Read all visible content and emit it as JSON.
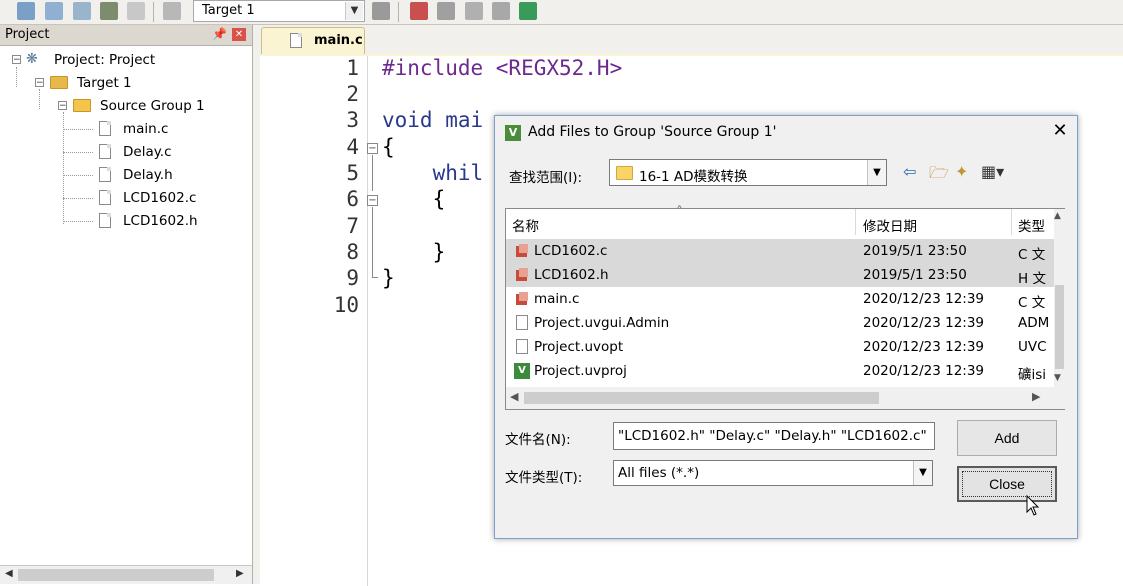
{
  "toolbar": {
    "target_select": "Target 1"
  },
  "project_panel": {
    "title": "Project",
    "tree": {
      "project": "Project: Project",
      "target": "Target 1",
      "group": "Source Group 1",
      "files": [
        "main.c",
        "Delay.c",
        "Delay.h",
        "LCD1602.c",
        "LCD1602.h"
      ]
    }
  },
  "editor": {
    "tab": "main.c",
    "line_numbers": [
      "1",
      "2",
      "3",
      "4",
      "5",
      "6",
      "7",
      "8",
      "9",
      "10"
    ],
    "code": [
      "#include <REGX52.H>",
      "",
      "void mai",
      "{",
      "    whil",
      "    {",
      "",
      "    }",
      "}",
      ""
    ]
  },
  "dialog": {
    "title": "Add Files to Group 'Source Group 1'",
    "look_in_label": "查找范围(I):",
    "look_in_value": "16-1 AD模数转换",
    "columns": {
      "name": "名称",
      "date": "修改日期",
      "type": "类型"
    },
    "files": [
      {
        "name": "LCD1602.c",
        "date": "2019/5/1 23:50",
        "type": "C 文",
        "selected": true,
        "icon": "c-file-icon"
      },
      {
        "name": "LCD1602.h",
        "date": "2019/5/1 23:50",
        "type": "H 文",
        "selected": true,
        "icon": "c-file-icon"
      },
      {
        "name": "main.c",
        "date": "2020/12/23 12:39",
        "type": "C 文",
        "selected": false,
        "icon": "c-file-icon"
      },
      {
        "name": "Project.uvgui.Admin",
        "date": "2020/12/23 12:39",
        "type": "ADM",
        "selected": false,
        "icon": "document-icon"
      },
      {
        "name": "Project.uvopt",
        "date": "2020/12/23 12:39",
        "type": "UVC",
        "selected": false,
        "icon": "document-icon"
      },
      {
        "name": "Project.uvproj",
        "date": "2020/12/23 12:39",
        "type": "礦isi",
        "selected": false,
        "icon": "uvision-project-icon"
      }
    ],
    "filename_label": "文件名(N):",
    "filename_value": "\"LCD1602.h\" \"Delay.c\" \"Delay.h\" \"LCD1602.c\"",
    "filetype_label": "文件类型(T):",
    "filetype_value": "All files (*.*)",
    "add_button": "Add",
    "close_button": "Close"
  },
  "colors": {
    "tab_bg": "#fbf4d2",
    "selection": "#d9d9d9",
    "dialog_bg": "#f0f0f0",
    "keyword_purple": "#6b2a8c",
    "include_blue": "#3a70a0"
  }
}
